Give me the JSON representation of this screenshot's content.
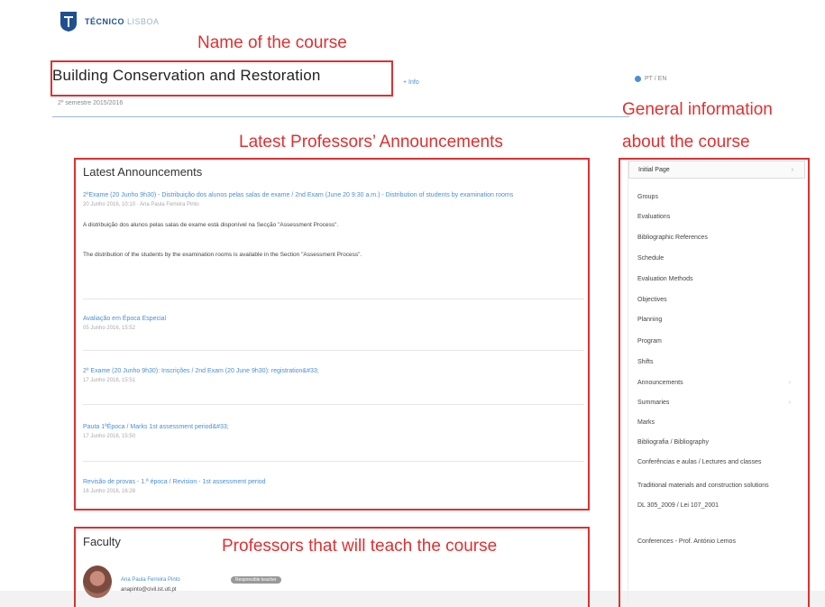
{
  "header": {
    "logo_text": "TÉCNICO",
    "logo_text_light": "LISBOA",
    "course_title": "Building Conservation and Restoration",
    "info_link": "+ Info",
    "semester": "2º semestre 2015/2016",
    "language": "PT / EN"
  },
  "annotations": {
    "name_of_course": "Name of the course",
    "general_info_line1": "General information",
    "general_info_line2": "about the course",
    "latest_professors_announcements": "Latest Professors’ Announcements",
    "professors_teach": "Professors that will teach the course"
  },
  "announcements": {
    "heading": "Latest Announcements",
    "main": {
      "title": "2ºExame (20 Junho 9h30) - Distribuição dos alunos pelas salas de exame / 2nd Exam (June 20 9:30 a.m.) - Distribution of students by examination rooms",
      "meta": "20 Junho 2016, 10:10 · Ana Paula Ferreira Pinto",
      "body_pt": "A distribuição dos alunos pelas salas de exame está disponível na Secção \"Assessment Process\".",
      "body_en": "The distribution of the students by the examination rooms is available in the Section \"Assessment Process\"."
    },
    "items": [
      {
        "title": "Avaliação em Época Especial",
        "meta": "05 Junho 2016, 15:52"
      },
      {
        "title": "2º Exame (20 Junho 9h30): Inscrições / 2nd Exam (20 June 9h30): registration&#33;",
        "meta": "17 Junho 2016, 15:51"
      },
      {
        "title": "Pauta 1ªÉpoca / Marks 1st assessment period&#33;",
        "meta": "17 Junho 2016, 15:50"
      },
      {
        "title": "Revisão de provas - 1.ª época / Revision - 1st assessment period",
        "meta": "16 Junho 2016, 16:28"
      }
    ]
  },
  "faculty": {
    "heading": "Faculty",
    "professor_name": "Ana Paula Ferreira Pinto",
    "professor_role": "Responsible teacher",
    "professor_email": "anapinto@civil.ist.utl.pt"
  },
  "sidebar": {
    "first": "Initial Page",
    "items": [
      "Groups",
      "Evaluations",
      "Bibliographic References",
      "Schedule",
      "Evaluation Methods",
      "Objectives",
      "Planning",
      "Program",
      "Shifts",
      "Announcements",
      "Summaries",
      "Marks",
      "Bibliografia / Bibliography",
      "Conferências e aulas / Lectures and classes",
      "Traditional materials and construction solutions",
      "DL 305_2009 / Lei 107_2001",
      "Conferences - Prof. António Lemos"
    ],
    "chevron_items": [
      9,
      10
    ]
  },
  "colors": {
    "accent": "#4a8fd1",
    "annotation": "#e03030",
    "brand": "#1f4f8f"
  }
}
